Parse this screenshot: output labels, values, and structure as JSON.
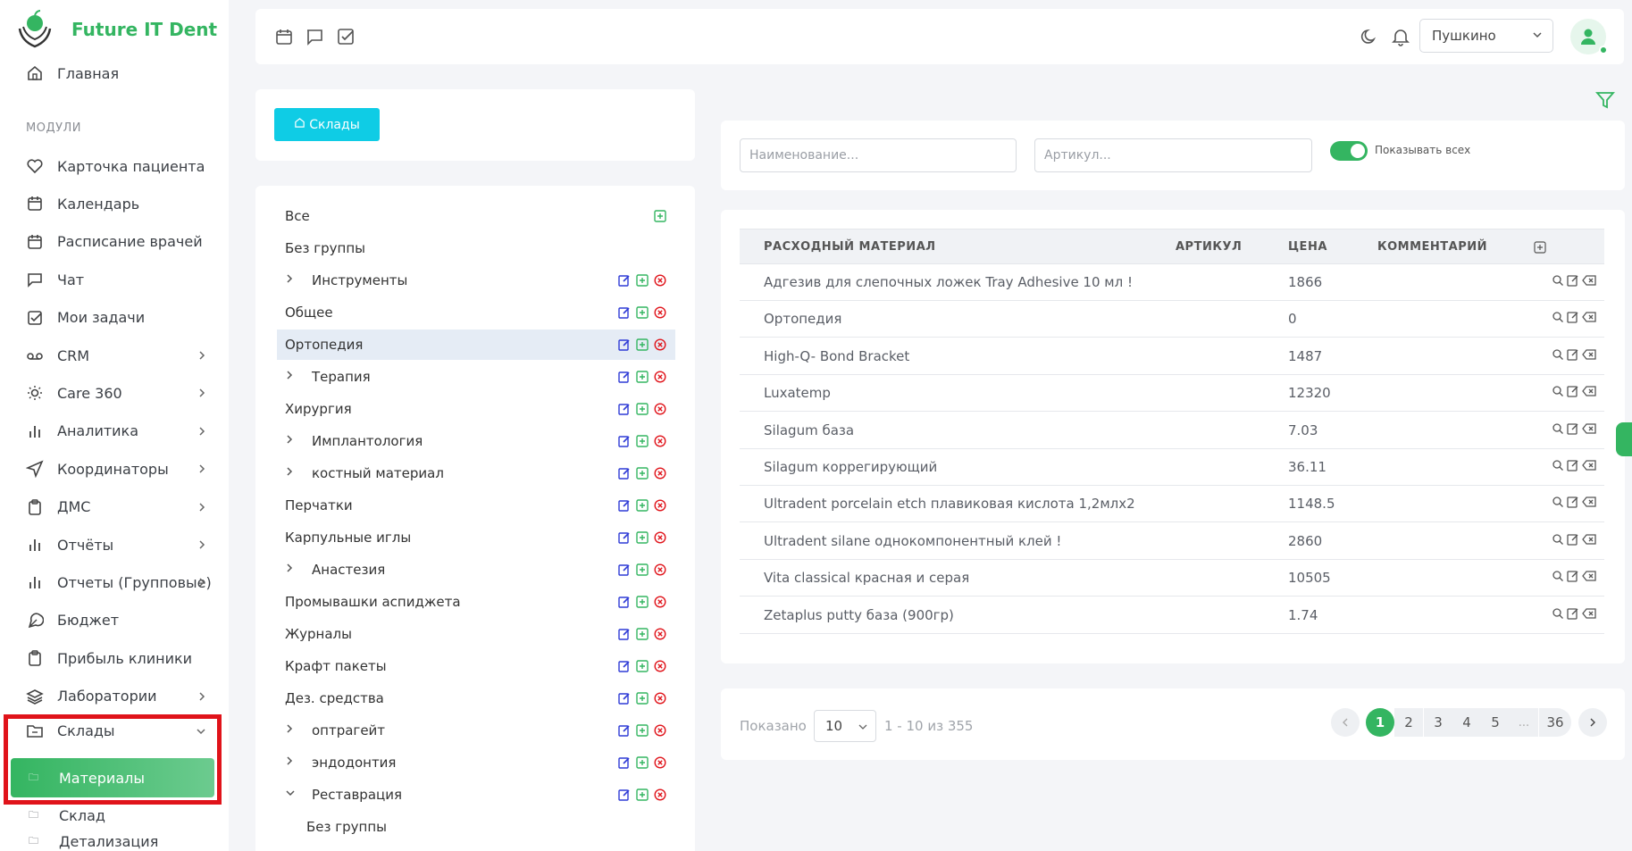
{
  "app": {
    "name": "Future IT Dent"
  },
  "sidebar": {
    "home": "Главная",
    "section_label": "МОДУЛИ",
    "items": [
      {
        "label": "Карточка пациента",
        "icon": "heart-icon"
      },
      {
        "label": "Календарь",
        "icon": "calendar-icon"
      },
      {
        "label": "Расписание врачей",
        "icon": "calendar-icon"
      },
      {
        "label": "Чат",
        "icon": "chat-icon"
      },
      {
        "label": "Мои задачи",
        "icon": "checkbox-icon"
      },
      {
        "label": "CRM",
        "icon": "voicemail-icon"
      },
      {
        "label": "Care 360",
        "icon": "sun-icon"
      },
      {
        "label": "Аналитика",
        "icon": "bar-chart-icon"
      },
      {
        "label": "Координаторы",
        "icon": "send-icon"
      },
      {
        "label": "ДМС",
        "icon": "clipboard-icon"
      },
      {
        "label": "Отчёты",
        "icon": "bar-chart-icon"
      },
      {
        "label": "Отчеты (Групповые)",
        "icon": "bar-chart-icon"
      },
      {
        "label": "Бюджет",
        "icon": "feather-icon"
      },
      {
        "label": "Прибыль клиники",
        "icon": "clipboard-icon"
      },
      {
        "label": "Лаборатории",
        "icon": "layers-icon"
      },
      {
        "label": "Склады",
        "icon": "folder-icon"
      }
    ],
    "sub_items": [
      {
        "label": "Материалы"
      },
      {
        "label": "Склад"
      },
      {
        "label": "Детализация"
      }
    ]
  },
  "topbar": {
    "location": "Пушкино"
  },
  "warehouses": {
    "button_label": "Склады",
    "groups": [
      {
        "label": "Все",
        "caret": "",
        "actions": "add"
      },
      {
        "label": "Без группы",
        "caret": "",
        "actions": "none"
      },
      {
        "label": "Инструменты",
        "caret": ">",
        "actions": "all"
      },
      {
        "label": "Общее",
        "caret": "",
        "actions": "all"
      },
      {
        "label": "Ортопедия",
        "caret": "",
        "actions": "all"
      },
      {
        "label": "Терапия",
        "caret": ">",
        "actions": "all"
      },
      {
        "label": "Хирургия",
        "caret": "",
        "actions": "all"
      },
      {
        "label": "Имплантология",
        "caret": ">",
        "actions": "all"
      },
      {
        "label": "костный материал",
        "caret": ">",
        "actions": "all"
      },
      {
        "label": "Перчатки",
        "caret": "",
        "actions": "all"
      },
      {
        "label": "Карпульные иглы",
        "caret": "",
        "actions": "all"
      },
      {
        "label": "Анастезия",
        "caret": ">",
        "actions": "all"
      },
      {
        "label": "Промывашки аспиджета",
        "caret": "",
        "actions": "all"
      },
      {
        "label": "Журналы",
        "caret": "",
        "actions": "all"
      },
      {
        "label": "Крафт пакеты",
        "caret": "",
        "actions": "all"
      },
      {
        "label": "Дез. средства",
        "caret": "",
        "actions": "all"
      },
      {
        "label": "оптрагейт",
        "caret": ">",
        "actions": "all"
      },
      {
        "label": "эндодонтия",
        "caret": ">",
        "actions": "all"
      },
      {
        "label": "Реставрация",
        "caret": "v",
        "actions": "all"
      },
      {
        "label": "Без группы",
        "caret": "",
        "actions": "none"
      }
    ],
    "selected_index": 4
  },
  "filters": {
    "name_placeholder": "Наименование...",
    "sku_placeholder": "Артикул...",
    "show_all_label": "Показывать всех",
    "show_all": true
  },
  "table": {
    "headers": [
      "РАСХОДНЫЙ МАТЕРИАЛ",
      "АРТИКУЛ",
      "ЦЕНА",
      "КОММЕНТАРИЙ"
    ],
    "rows": [
      {
        "name": "Адгезив для слепочных ложек Tray Adhesive 10 мл !",
        "sku": "",
        "price": "1866",
        "comment": ""
      },
      {
        "name": "Ортопедия",
        "sku": "",
        "price": "0",
        "comment": ""
      },
      {
        "name": "High-Q- Bond Bracket",
        "sku": "",
        "price": "1487",
        "comment": ""
      },
      {
        "name": "Luxatemp",
        "sku": "",
        "price": "12320",
        "comment": ""
      },
      {
        "name": "Silagum база",
        "sku": "",
        "price": "7.03",
        "comment": ""
      },
      {
        "name": "Silagum коррегирующий",
        "sku": "",
        "price": "36.11",
        "comment": ""
      },
      {
        "name": "Ultradent porcelain etch плавиковая кислота 1,2млх2",
        "sku": "",
        "price": "1148.5",
        "comment": ""
      },
      {
        "name": "Ultradent silane однокомпонентный клей !",
        "sku": "",
        "price": "2860",
        "comment": ""
      },
      {
        "name": "Vita classical красная и серая",
        "sku": "",
        "price": "10505",
        "comment": ""
      },
      {
        "name": "Zetaplus putty база (900гр)",
        "sku": "",
        "price": "1.74",
        "comment": ""
      }
    ]
  },
  "pagination": {
    "shown_label": "Показано",
    "page_size": "10",
    "range_text": "1 - 10 из 355",
    "pages": [
      "1",
      "2",
      "3",
      "4",
      "5",
      "...",
      "36"
    ],
    "current": "1"
  },
  "colors": {
    "brand": "#34b561",
    "button": "#0fcce5",
    "edit": "#2f3bd6",
    "add": "#34b561",
    "delete": "#e0131a",
    "highlight": "#e0131a"
  }
}
